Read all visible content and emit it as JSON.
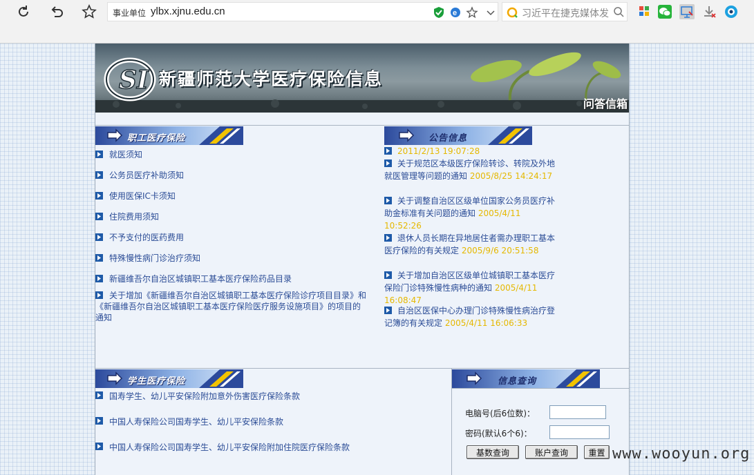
{
  "browser": {
    "address_tag": "事业单位",
    "url": "ylbx.xjnu.edu.cn",
    "search_placeholder": "习近平在捷克媒体发"
  },
  "banner": {
    "title": "新疆师范大学医疗保险信息",
    "logo_text": "SI",
    "qa_link": "问答信箱"
  },
  "employee_section": {
    "header": "职工医疗保险",
    "items": [
      "就医须知",
      "公务员医疗补助须知",
      "使用医保IC卡须知",
      "住院费用须知",
      "不予支付的医药费用",
      "特殊慢性病门诊治疗须知",
      "新疆维吾尔自治区城镇职工基本医疗保险药品目录",
      "关于增加《新疆维吾尔自治区城镇职工基本医疗保险诊疗项目目录》和《新疆维吾尔自治区城镇职工基本医疗保险医疗服务设施项目》的项目的通知"
    ]
  },
  "notice_section": {
    "header": "公告信息",
    "items": [
      {
        "title": "",
        "date": "2011/2/13 19:07:28"
      },
      {
        "title": "关于规范区本级医疗保险转诊、转院及外地就医管理等问题的通知",
        "date": "2005/8/25 14:24:17"
      },
      {
        "title": "关于调整自治区区级单位国家公务员医疗补助金标准有关问题的通知",
        "date": "2005/4/11 10:52:26"
      },
      {
        "title": "退休人员长期在异地居住者需办理职工基本医疗保险的有关规定",
        "date": "2005/9/6 20:51:58"
      },
      {
        "title": "关于增加自治区区级单位城镇职工基本医疗保险门诊特殊慢性病种的通知",
        "date": "2005/4/11 16:08:47"
      },
      {
        "title": "自治区医保中心办理门诊特殊慢性病治疗登记簿的有关规定",
        "date": "2005/4/11 16:06:33"
      }
    ]
  },
  "student_section": {
    "header": "学生医疗保险",
    "items": [
      "国寿学生、幼儿平安保险附加意外伤害医疗保险条款",
      "中国人寿保险公司国寿学生、幼儿平安保险条款",
      "中国人寿保险公司国寿学生、幼儿平安保险附加住院医疗保险条款"
    ]
  },
  "query_section": {
    "header": "信息查询",
    "computer_label": "电脑号(后6位数)：",
    "password_label": "密码(默认6个6)：",
    "computer_value": "",
    "password_value": "",
    "btn_basic": "基数查询",
    "btn_account": "账户查询",
    "btn_reset": "重置"
  },
  "watermark": "www.wooyun.org",
  "colors": {
    "link": "#2b4c96",
    "date": "#e5b800",
    "header_dark": "#1f2f6e",
    "bullet": "#1e5aa8"
  }
}
